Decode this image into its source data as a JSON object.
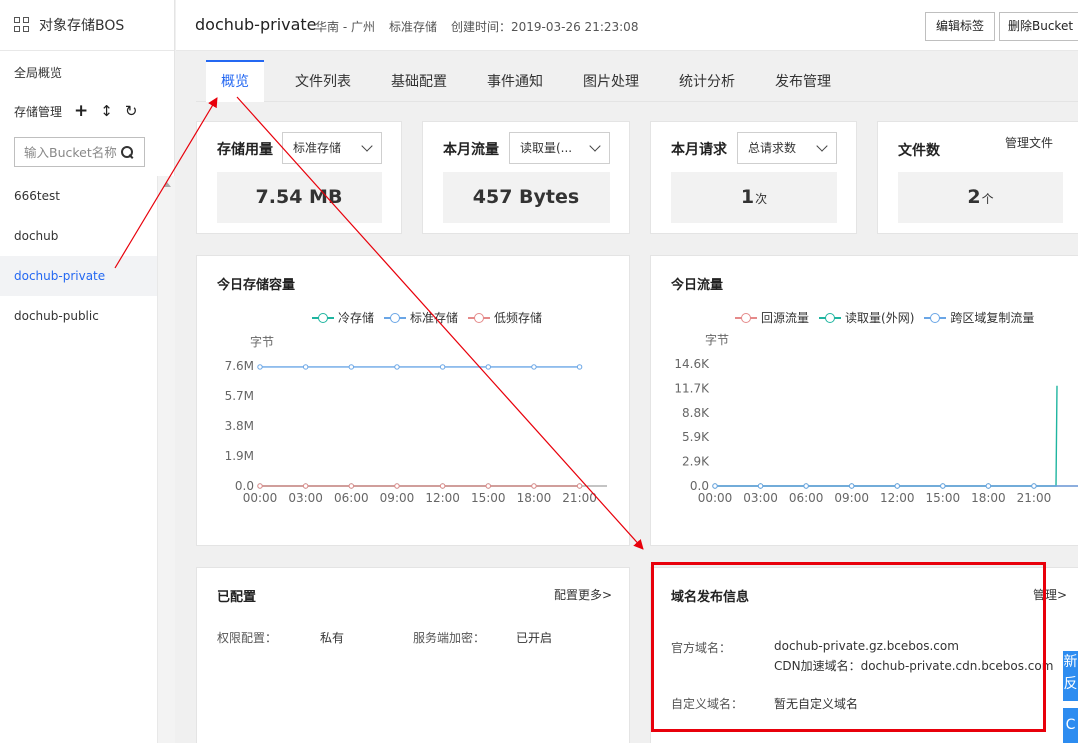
{
  "app": {
    "title": "对象存储BOS"
  },
  "sidebar": {
    "overview": "全局概览",
    "storage_manage": "存储管理",
    "add_icon": "plus-icon",
    "sort_icon": "sort-icon",
    "refresh_icon": "refresh-icon",
    "search_placeholder": "输入Bucket名称",
    "buckets": [
      "666test",
      "dochub",
      "dochub-private",
      "dochub-public"
    ],
    "active_bucket": "dochub-private"
  },
  "header": {
    "bucket_name": "dochub-private",
    "region": "华南 - 广州",
    "storage_class": "标准存储",
    "created": "创建时间：2019-03-26 21:23:08",
    "edit_tags": "编辑标签",
    "delete_bucket": "删除Bucket"
  },
  "tabs": [
    "概览",
    "文件列表",
    "基础配置",
    "事件通知",
    "图片处理",
    "统计分析",
    "发布管理"
  ],
  "active_tab": "概览",
  "stats": [
    {
      "label": "存储用量",
      "select": "标准存储",
      "value": "7.54 MB",
      "unit": ""
    },
    {
      "label": "本月流量",
      "select": "读取量(...",
      "value": "457 Bytes",
      "unit": ""
    },
    {
      "label": "本月请求",
      "select": "总请求数",
      "value": "1",
      "unit": "次"
    },
    {
      "label": "文件数",
      "link": "管理文件",
      "value": "2",
      "unit": "个"
    }
  ],
  "colors": {
    "accent": "#2468f2",
    "red": "#e8000b",
    "teal": "#1fb5a0",
    "blue": "#6aa6e6",
    "salmon": "#e58a8a"
  },
  "chart_data": [
    {
      "type": "line",
      "title": "今日存储容量",
      "ylabel": "字节",
      "x": [
        "00:00",
        "03:00",
        "06:00",
        "09:00",
        "12:00",
        "15:00",
        "18:00",
        "21:00"
      ],
      "yticks": [
        "0.0",
        "1.9M",
        "3.8M",
        "5.7M",
        "7.6M"
      ],
      "ylim": [
        0,
        7.6
      ],
      "series": [
        {
          "name": "冷存储",
          "color": "#1fb5a0",
          "values": [
            0,
            0,
            0,
            0,
            0,
            0,
            0,
            0
          ]
        },
        {
          "name": "标准存储",
          "color": "#6aa6e6",
          "values": [
            7.54,
            7.54,
            7.54,
            7.54,
            7.54,
            7.54,
            7.54,
            7.54
          ]
        },
        {
          "name": "低频存储",
          "color": "#e58a8a",
          "values": [
            0,
            0,
            0,
            0,
            0,
            0,
            0,
            0
          ]
        }
      ]
    },
    {
      "type": "line",
      "title": "今日流量",
      "ylabel": "字节",
      "x": [
        "00:00",
        "03:00",
        "06:00",
        "09:00",
        "12:00",
        "15:00",
        "18:00",
        "21:00"
      ],
      "yticks": [
        "0.0",
        "2.9K",
        "5.9K",
        "8.8K",
        "11.7K",
        "14.6K"
      ],
      "ylim": [
        0,
        14.6
      ],
      "series": [
        {
          "name": "回源流量",
          "color": "#e58a8a",
          "values": [
            0,
            0,
            0,
            0,
            0,
            0,
            0,
            0,
            0
          ]
        },
        {
          "name": "读取量(外网)",
          "color": "#1fb5a0",
          "values": [
            0,
            0,
            0,
            0,
            0,
            0,
            0,
            0,
            0,
            12
          ]
        },
        {
          "name": "跨区域复制流量",
          "color": "#6aa6e6",
          "values": [
            0,
            0,
            0,
            0,
            0,
            0,
            0,
            0,
            0
          ]
        }
      ]
    }
  ],
  "config": {
    "title": "已配置",
    "more": "配置更多>",
    "permission_label": "权限配置：",
    "permission_value": "私有",
    "encryption_label": "服务端加密：",
    "encryption_value": "已开启"
  },
  "domain": {
    "title": "域名发布信息",
    "manage": "管理>",
    "official_label": "官方域名：",
    "official_value": "dochub-private.gz.bcebos.com",
    "cdn_line": "CDN加速域名：dochub-private.cdn.bcebos.com",
    "custom_label": "自定义域名：",
    "custom_value": "暂无自定义域名"
  },
  "floating": {
    "btn1": "新反",
    "btn2": "C"
  }
}
